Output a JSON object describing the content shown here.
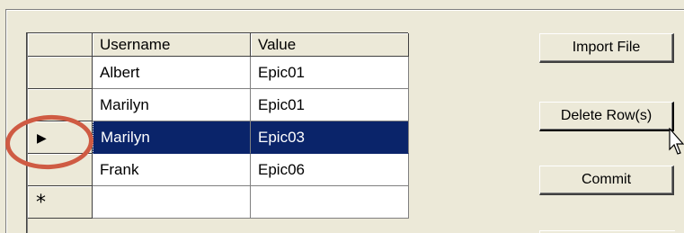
{
  "grid": {
    "columns": [
      "",
      "Username",
      "Value"
    ],
    "rows": [
      {
        "indicator": "",
        "username": "Albert",
        "value": "Epic01"
      },
      {
        "indicator": "",
        "username": "Marilyn",
        "value": "Epic01"
      },
      {
        "indicator": "current-row-arrow-icon",
        "username": "Marilyn",
        "value": "Epic03",
        "selected": true
      },
      {
        "indicator": "",
        "username": "Frank",
        "value": "Epic06"
      },
      {
        "indicator": "new-row-icon",
        "username": "",
        "value": ""
      }
    ],
    "current_row_glyph": "▶",
    "new_row_glyph": "*"
  },
  "buttons": {
    "import_label": "Import File",
    "delete_label": "Delete Row(s)",
    "commit_label": "Commit"
  },
  "colors": {
    "selection": "#0a246a",
    "annotation": "#cf5b43",
    "face": "#ece9d8"
  }
}
